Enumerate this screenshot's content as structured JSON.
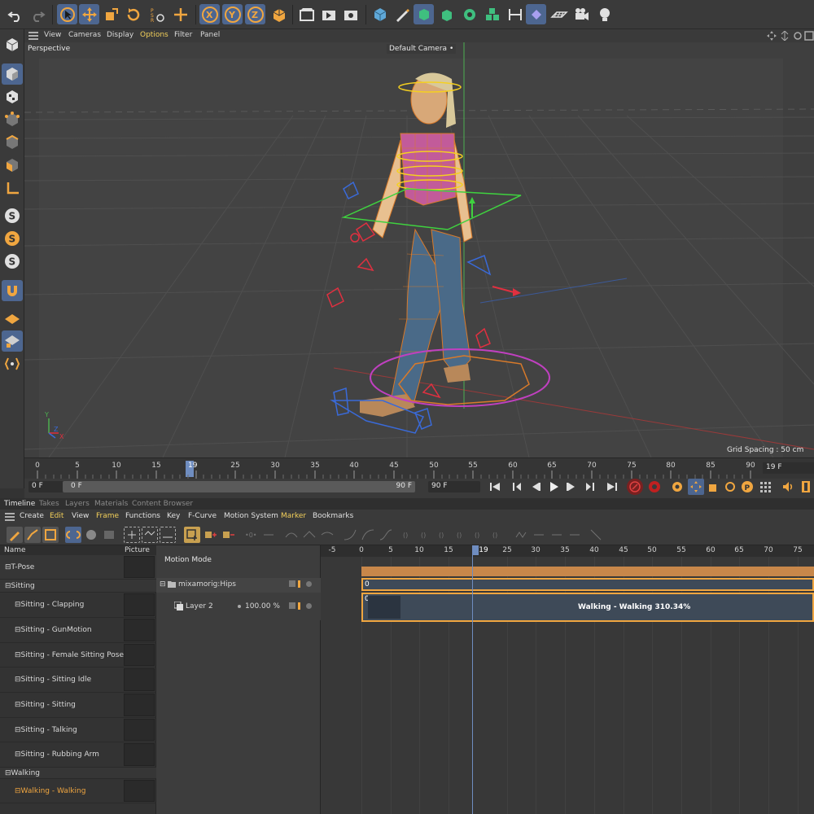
{
  "colors": {
    "accent_blue": "#4d6690",
    "highlight_yellow": "#f2cf5a",
    "selection_orange": "#f0a640",
    "clip_border": "#f0a640"
  },
  "top_toolbar": {
    "icons": [
      "undo-icon",
      "redo-icon",
      "select-icon",
      "move-icon",
      "scale-icon",
      "rotate-icon",
      "psr-icon",
      "transform-icon",
      "x-axis-icon",
      "y-axis-icon",
      "z-axis-icon",
      "coordinate-system-icon",
      "render-view-icon",
      "render-picture-viewer-icon",
      "render-settings-icon",
      "cube-icon",
      "pen-icon",
      "subdivision-icon",
      "extrude-icon",
      "cloner-icon",
      "mograph-icon",
      "bend-icon",
      "joint-icon",
      "floor-icon",
      "camera-icon",
      "light-icon"
    ]
  },
  "left_palette": {
    "icons": [
      "model-mode-icon",
      "object-mode-icon",
      "texture-mode-icon",
      "points-mode-icon",
      "edges-mode-icon",
      "polygons-mode-icon",
      "axis-mode-icon",
      "snap-icon",
      "snap-settings-icon",
      "snap-quantize-icon",
      "magnet-icon",
      "workplane-icon",
      "locked-workplane-icon",
      "solo-icon"
    ]
  },
  "viewport": {
    "menu": [
      "View",
      "Cameras",
      "Display",
      "Options",
      "Filter",
      "Panel"
    ],
    "active_menu": "Options",
    "label": "Perspective",
    "camera": "Default Camera",
    "grid_spacing": "Grid Spacing : 50 cm"
  },
  "ruler": {
    "ticks": [
      "0",
      "5",
      "10",
      "15",
      "19",
      "25",
      "30",
      "35",
      "40",
      "45",
      "50",
      "55",
      "60",
      "65",
      "70",
      "75",
      "80",
      "85",
      "90"
    ],
    "current_frame": "19 F"
  },
  "transport": {
    "start_frame": "0 F",
    "range_start": "0 F",
    "range_end": "90 F",
    "end_frame": "90 F"
  },
  "timeline": {
    "tabs": [
      "Timeline",
      "Takes",
      "Layers",
      "Materials",
      "Content Browser"
    ],
    "active_tab": "Timeline",
    "menu": [
      "Create",
      "Edit",
      "View",
      "Frame",
      "Functions",
      "Key",
      "F-Curve",
      "Motion System",
      "Marker",
      "Bookmarks"
    ],
    "take_list": {
      "headers": {
        "name": "Name",
        "picture": "Picture"
      },
      "items": [
        {
          "label": "T-Pose",
          "indent": 1
        },
        {
          "label": "Sitting",
          "indent": 1
        },
        {
          "label": "Sitting - Clapping",
          "indent": 2
        },
        {
          "label": "Sitting - GunMotion",
          "indent": 2
        },
        {
          "label": "Sitting - Female Sitting Pose",
          "indent": 2
        },
        {
          "label": "Sitting - Sitting Idle",
          "indent": 2
        },
        {
          "label": "Sitting - Sitting",
          "indent": 2
        },
        {
          "label": "Sitting - Talking",
          "indent": 2
        },
        {
          "label": "Sitting - Rubbing Arm",
          "indent": 2
        },
        {
          "label": "Walking",
          "indent": 1
        },
        {
          "label": "Walking - Walking",
          "indent": 2
        }
      ]
    },
    "motion_panel": {
      "mode_label": "Motion Mode",
      "object_name": "mixamorig:Hips",
      "layer_name": "Layer 2",
      "layer_strength": "100.00 %"
    },
    "nla": {
      "ticks": [
        "-5",
        "0",
        "5",
        "10",
        "15",
        "19",
        "25",
        "30",
        "35",
        "40",
        "45",
        "50",
        "55",
        "60",
        "65",
        "70",
        "75"
      ],
      "track1_start": "0",
      "track2_start": "0",
      "clip_label": "Walking - Walking  310.34%"
    }
  }
}
